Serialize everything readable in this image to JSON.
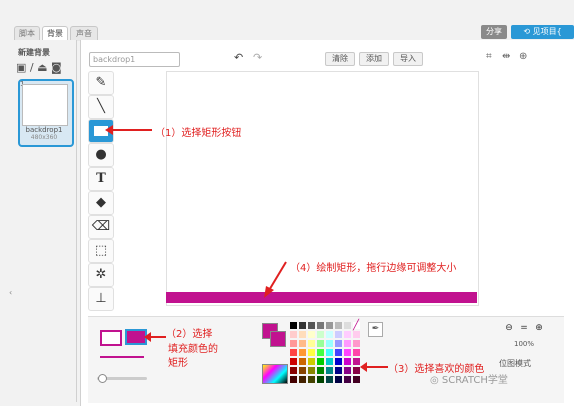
{
  "tabs": [
    {
      "label": "脚本",
      "active": false
    },
    {
      "label": "背景",
      "active": true
    },
    {
      "label": "声音",
      "active": false
    }
  ],
  "header": {
    "share_label": "分享",
    "project_label": "见项目{"
  },
  "left": {
    "title": "新建背景",
    "backdrop_number": "1",
    "backdrop_name": "backdrop1",
    "backdrop_size": "480x360"
  },
  "editor": {
    "name_value": "backdrop1",
    "clear_label": "清除",
    "add_label": "添加",
    "import_label": "导入"
  },
  "annotations": {
    "a1": "（1）选择矩形按钮",
    "a2_line1": "（2）选择",
    "a2_line2": "填充颜色的",
    "a2_line3": "矩形",
    "a3": "（3）选择喜欢的颜色",
    "a4": "（4）绘制矩形，拖行边缘可调整大小"
  },
  "bottom": {
    "zoom": "100%",
    "mode_label": "位图模式",
    "watermark": "SCRATCH学堂"
  },
  "colors": {
    "accent": "#2a98d6",
    "rect": "#c1128f",
    "annot": "#e02020"
  }
}
